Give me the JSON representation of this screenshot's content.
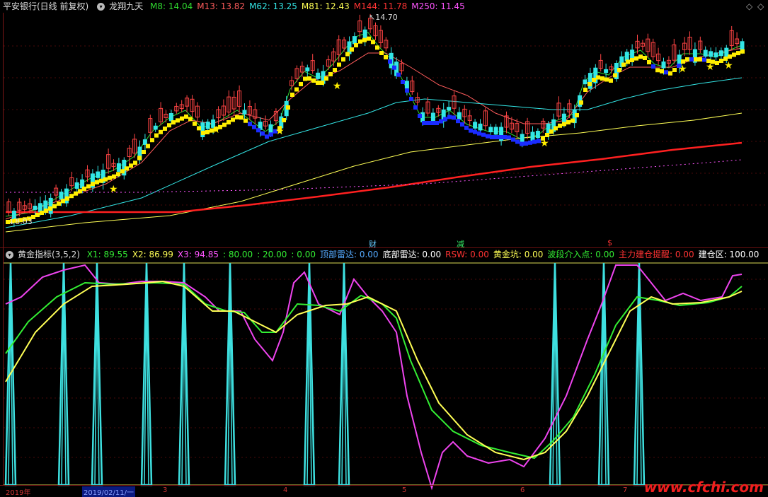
{
  "main_header": {
    "stock": "平安银行(日线 前复权)",
    "indicator": "龙翔九天",
    "ma": [
      {
        "label": "M8: 14.04",
        "color": "#2fd82f"
      },
      {
        "label": "M13: 13.82",
        "color": "#ff5c5c"
      },
      {
        "label": "M62: 13.25",
        "color": "#33e6e6"
      },
      {
        "label": "M81: 12.43",
        "color": "#ffff55"
      },
      {
        "label": "M144: 11.78",
        "color": "#ff3333"
      },
      {
        "label": "M250: 11.45",
        "color": "#ff55ff"
      }
    ]
  },
  "price_labels": {
    "high": "14.70",
    "low": "8.03"
  },
  "event_markers": [
    {
      "text": "财",
      "color": "#66ccff"
    },
    {
      "text": "减",
      "color": "#33ee66"
    },
    {
      "text": "$",
      "color": "#ff3333"
    }
  ],
  "sub_header": {
    "name": "黄金指标(3,5,2)",
    "items": [
      {
        "label": "X1: 89.55",
        "color": "#33ee33"
      },
      {
        "label": "X2: 86.99",
        "color": "#ffff55"
      },
      {
        "label": "X3: 94.85",
        "color": "#ff55ff"
      },
      {
        "label": ": 80.00",
        "color": "#33ee33"
      },
      {
        "label": ": 20.00",
        "color": "#33ee33"
      },
      {
        "label": ": 0.00",
        "color": "#33ee33"
      },
      {
        "label": "顶部雷达: 0.00",
        "color": "#55aaff"
      },
      {
        "label": "底部雷达: 0.00",
        "color": "#ffffff"
      },
      {
        "label": "RSW: 0.00",
        "color": "#ff3333"
      },
      {
        "label": "黄金坑: 0.00",
        "color": "#ffff55"
      },
      {
        "label": "波段介入点: 0.00",
        "color": "#33ee33"
      },
      {
        "label": "主力建仓提醒: 0.00",
        "color": "#ff3333"
      },
      {
        "label": "建仓区: 100.00",
        "color": "#ffffff"
      }
    ]
  },
  "x_axis": [
    {
      "text": "2019年",
      "selected": false
    },
    {
      "text": "2019/02/11/一",
      "selected": true
    },
    {
      "text": "3",
      "selected": false
    },
    {
      "text": "4",
      "selected": false
    },
    {
      "text": "5",
      "selected": false
    },
    {
      "text": "6",
      "selected": false
    },
    {
      "text": "7",
      "selected": false
    }
  ],
  "watermark": "www.cfchi.com"
}
